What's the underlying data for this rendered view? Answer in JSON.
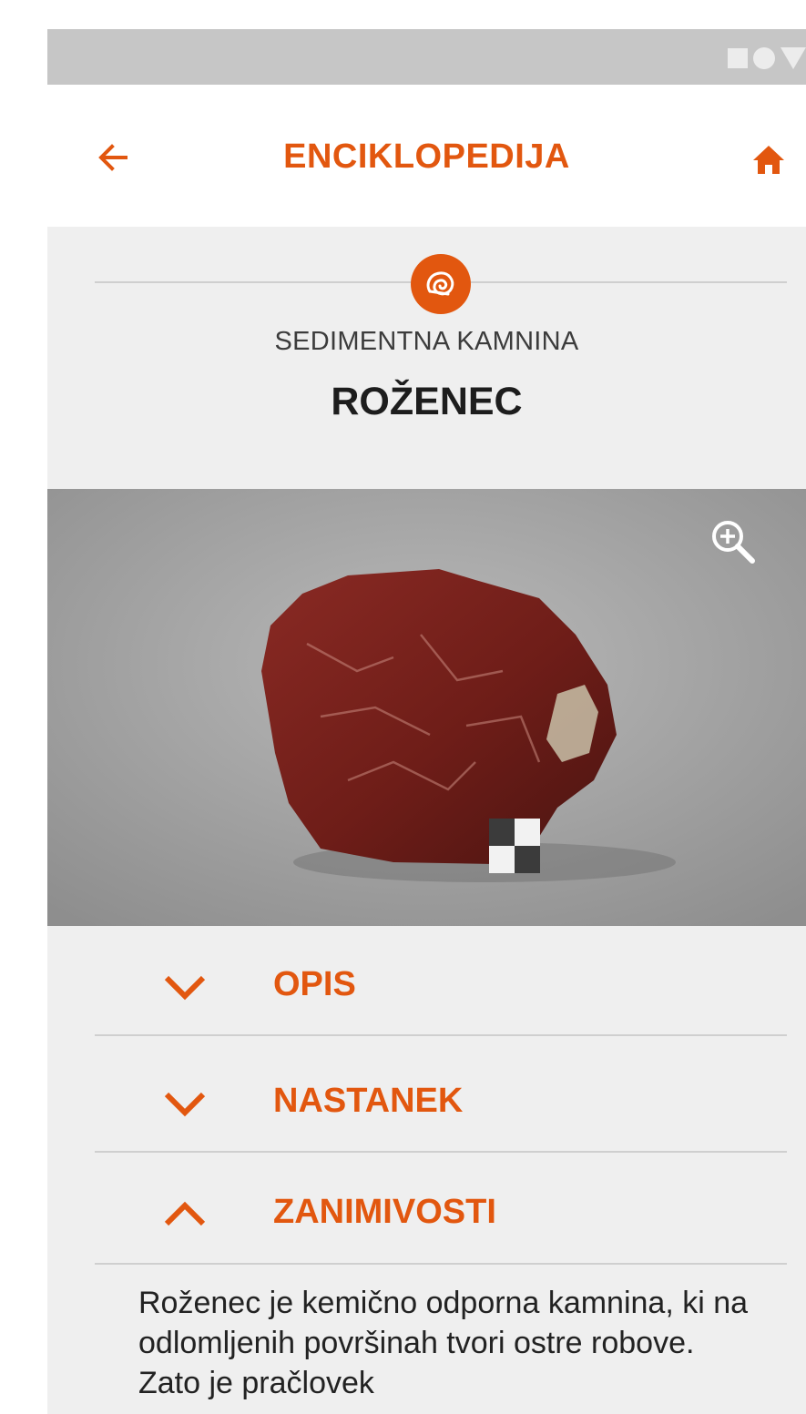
{
  "status_bar": {
    "icons": [
      "square-icon",
      "circle-icon",
      "triangle-icon"
    ]
  },
  "header": {
    "title": "ENCIKLOPEDIJA",
    "back_icon": "arrow-left-icon",
    "home_icon": "home-icon"
  },
  "item": {
    "category_icon": "ammonite-icon",
    "category": "SEDIMENTNA KAMNINA",
    "name": "ROŽENEC",
    "photo_zoom_icon": "zoom-in-icon"
  },
  "sections": [
    {
      "label": "OPIS",
      "expanded": false
    },
    {
      "label": "NASTANEK",
      "expanded": false
    },
    {
      "label": "ZANIMIVOSTI",
      "expanded": true
    }
  ],
  "description": "Roženec je kemično odporna kamnina, ki na odlomljenih površinah tvori ostre robove. Zato je pračlovek",
  "colors": {
    "accent": "#e2570f",
    "background": "#efefef",
    "status_bar": "#c6c6c6"
  }
}
